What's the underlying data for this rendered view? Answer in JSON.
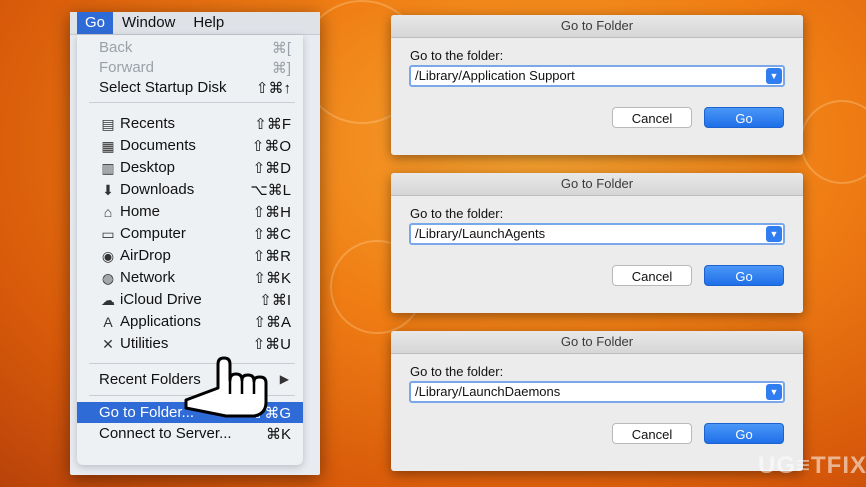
{
  "menubar": {
    "items": [
      "Go",
      "Window",
      "Help"
    ]
  },
  "menu": {
    "back": {
      "label": "Back",
      "shortcut": "⌘["
    },
    "forward": {
      "label": "Forward",
      "shortcut": "⌘]"
    },
    "startup": {
      "label": "Select Startup Disk",
      "shortcut": "⇧⌘↑"
    },
    "places": [
      {
        "label": "Recents",
        "shortcut": "⇧⌘F",
        "icon": "recents-icon",
        "glyph": "▤"
      },
      {
        "label": "Documents",
        "shortcut": "⇧⌘O",
        "icon": "documents-icon",
        "glyph": "▦"
      },
      {
        "label": "Desktop",
        "shortcut": "⇧⌘D",
        "icon": "desktop-icon",
        "glyph": "▥"
      },
      {
        "label": "Downloads",
        "shortcut": "⌥⌘L",
        "icon": "downloads-icon",
        "glyph": "⬇"
      },
      {
        "label": "Home",
        "shortcut": "⇧⌘H",
        "icon": "home-icon",
        "glyph": "⌂"
      },
      {
        "label": "Computer",
        "shortcut": "⇧⌘C",
        "icon": "computer-icon",
        "glyph": "▭"
      },
      {
        "label": "AirDrop",
        "shortcut": "⇧⌘R",
        "icon": "airdrop-icon",
        "glyph": "◉"
      },
      {
        "label": "Network",
        "shortcut": "⇧⌘K",
        "icon": "network-icon",
        "glyph": "◍"
      },
      {
        "label": "iCloud Drive",
        "shortcut": "⇧⌘I",
        "icon": "icloud-icon",
        "glyph": "☁"
      },
      {
        "label": "Applications",
        "shortcut": "⇧⌘A",
        "icon": "applications-icon",
        "glyph": "A"
      },
      {
        "label": "Utilities",
        "shortcut": "⇧⌘U",
        "icon": "utilities-icon",
        "glyph": "✕"
      }
    ],
    "recent_folders": {
      "label": "Recent Folders",
      "arrow": "▶"
    },
    "go_to_folder": {
      "label": "Go to Folder...",
      "shortcut": "⇧⌘G"
    },
    "connect": {
      "label": "Connect to Server...",
      "shortcut": "⌘K"
    }
  },
  "dialogs": [
    {
      "title": "Go to Folder",
      "label": "Go to the folder:",
      "value": "/Library/Application Support",
      "cancel": "Cancel",
      "go": "Go"
    },
    {
      "title": "Go to Folder",
      "label": "Go to the folder:",
      "value": "/Library/LaunchAgents",
      "cancel": "Cancel",
      "go": "Go"
    },
    {
      "title": "Go to Folder",
      "label": "Go to the folder:",
      "value": "/Library/LaunchDaemons",
      "cancel": "Cancel",
      "go": "Go"
    }
  ],
  "watermark": "UG≡TFIX",
  "colors": {
    "highlight": "#2f6bd6",
    "go_button": "#1f6fe9",
    "background": "#ef7d14"
  }
}
